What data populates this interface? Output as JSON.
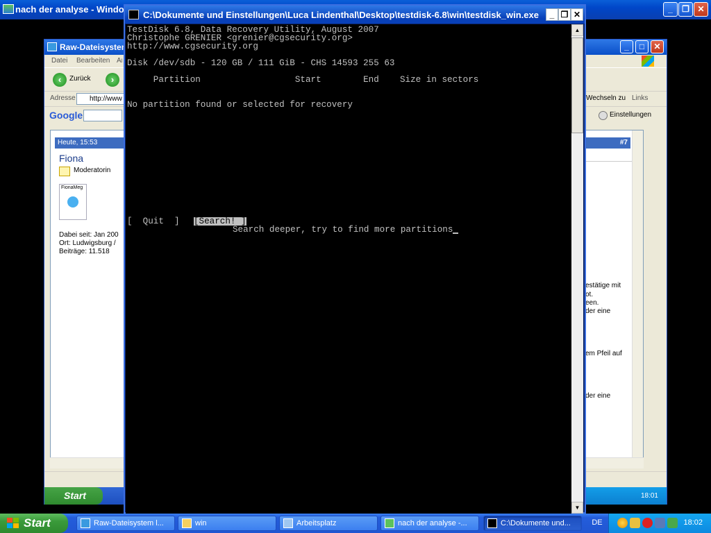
{
  "outer_window": {
    "title": "nach der analyse - Windows Bild- und Faxanzeige"
  },
  "inner_ie": {
    "title": "Raw-Dateisystem",
    "menu": [
      "Datei",
      "Bearbeiten",
      "Ansicht"
    ],
    "back_label": "Zurück",
    "address_label": "Adresse",
    "address_value": "http://www",
    "google_label": "Google",
    "links_label": "Links",
    "switch_label": "Wechseln zu",
    "settings_label": "Einstellungen",
    "post": {
      "date": "Heute, 15:53",
      "number": "#7",
      "user": "Fiona",
      "role": "Moderatorin",
      "avatar_caption": "FionaMeg",
      "joined": "Dabei seit: Jan 200",
      "location": "Ort: Ludwigsburg /",
      "posts": "Beiträge: 11.518",
      "right_text_1": "estätige mit",
      "right_text_2": "ot.",
      "right_text_3": "een.",
      "right_text_4": "der eine",
      "right_text_5": "em Pfeil auf",
      "right_text_6": "der eine"
    },
    "taskbar_start": "Start",
    "clock": "18:01"
  },
  "console": {
    "title": "C:\\Dokumente und Einstellungen\\Luca Lindenthal\\Desktop\\testdisk-6.8\\win\\testdisk_win.exe",
    "lines": {
      "header1": "TestDisk 6.8, Data Recovery Utility, August 2007",
      "header2": "Christophe GRENIER <grenier@cgsecurity.org>",
      "header3": "http://www.cgsecurity.org",
      "disk": "Disk /dev/sdb - 120 GB / 111 GiB - CHS 14593 255 63",
      "columns": "     Partition                  Start        End    Size in sectors",
      "message": "No partition found or selected for recovery",
      "quit_button": "[  Quit  ]",
      "search_button": "[Search! ]",
      "hint": "Search deeper, try to find more partitions"
    }
  },
  "taskbar": {
    "start_label": "Start",
    "tasks": [
      {
        "label": "Raw-Dateisystem l..."
      },
      {
        "label": "win"
      },
      {
        "label": "Arbeitsplatz"
      },
      {
        "label": "nach der analyse -..."
      },
      {
        "label": "C:\\Dokumente und..."
      }
    ],
    "language": "DE",
    "clock": "18:02"
  },
  "colors": {
    "xp_blue": "#245ddb",
    "console_text": "#c0c0c0",
    "console_bg": "#000000"
  }
}
